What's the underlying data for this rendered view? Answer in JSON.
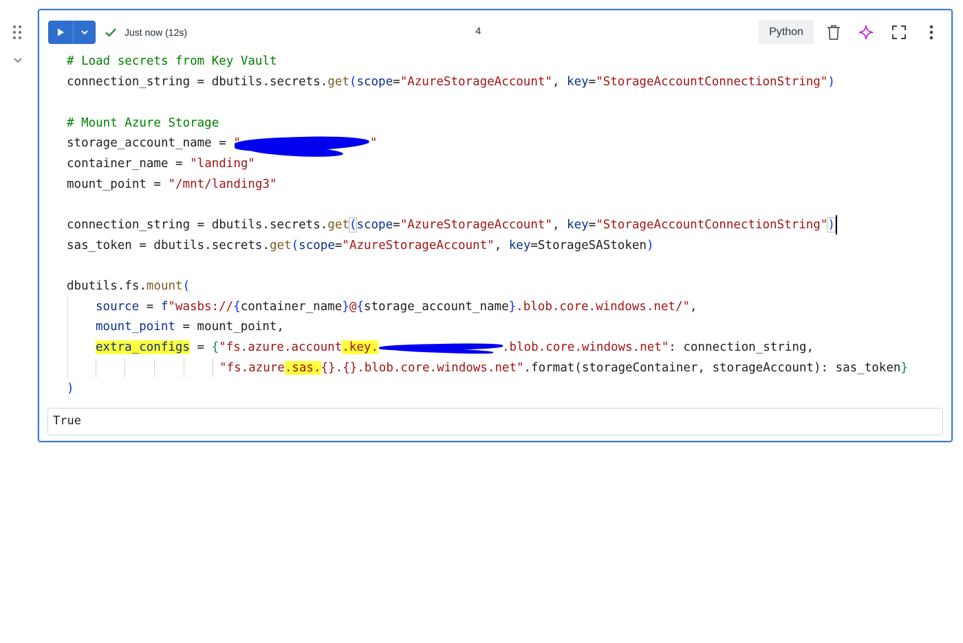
{
  "toolbar": {
    "status_text": "Just now (12s)",
    "cell_number": "4",
    "language": "Python"
  },
  "code": {
    "line1": "# Load secrets from Key Vault",
    "line2_a": "connection_string = dbutils.secrets.",
    "line2_fn": "get",
    "line2_p1": "(",
    "line2_k1": "scope",
    "line2_eq1": "=",
    "line2_s1": "\"AzureStorageAccount\"",
    "line2_c": ", ",
    "line2_k2": "key",
    "line2_eq2": "=",
    "line2_s2": "\"StorageAccountConnectionString\"",
    "line2_p2": ")",
    "line4": "# Mount Azure Storage",
    "line5_a": "storage_account_name = ",
    "line5_s": "\"",
    "line5_e": "\"",
    "line6_a": "container_name = ",
    "line6_s": "\"landing\"",
    "line7_a": "mount_point = ",
    "line7_s": "\"/mnt/landing3\"",
    "line9_a": "connection_string = dbutils.secrets.",
    "line9_fn": "get",
    "line9_p1": "(",
    "line9_k1": "scope",
    "line9_eq1": "=",
    "line9_s1": "\"AzureStorageAccount\"",
    "line9_c": ", ",
    "line9_k2": "key",
    "line9_eq2": "=",
    "line9_s2": "\"StorageAccountConnectionString\"",
    "line9_p2": ")",
    "line10_a": "sas_token = dbutils.secrets.",
    "line10_fn": "get",
    "line10_p1": "(",
    "line10_k1": "scope",
    "line10_eq1": "=",
    "line10_s1": "\"AzureStorageAccount\"",
    "line10_c": ", ",
    "line10_k2": "key",
    "line10_rest": "=StorageSAStoken",
    "line10_p2": ")",
    "line12_a": "dbutils.fs.",
    "line12_fn": "mount",
    "line12_p": "(",
    "line13_k": "source",
    "line13_eq": " = ",
    "line13_f": "f",
    "line13_s1": "\"wasbs://",
    "line13_b1": "{",
    "line13_v1": "container_name",
    "line13_b2": "}",
    "line13_s2": "@",
    "line13_b3": "{",
    "line13_v2": "storage_account_name",
    "line13_b4": "}",
    "line13_s3": ".blob.core.windows.net/\"",
    "line13_end": ",",
    "line14_k": "mount_point",
    "line14_rest": " = mount_point,",
    "line15_k": "extra_configs",
    "line15_eq": " = ",
    "line15_b": "{",
    "line15_s1": "\"fs.azure.account",
    "line15_hl": ".key.",
    "line15_s2": ".blob.core.windows.net\"",
    "line15_rest": ": connection_string,",
    "line16_s1": "\"fs.azure",
    "line16_hl": ".sas.",
    "line16_s2": "{}.{}.blob.core.windows.net\"",
    "line16_rest": ".format(storageContainer, storageAccount): sas_token",
    "line16_b": "}",
    "line17": ")"
  },
  "output": {
    "text": "True"
  }
}
